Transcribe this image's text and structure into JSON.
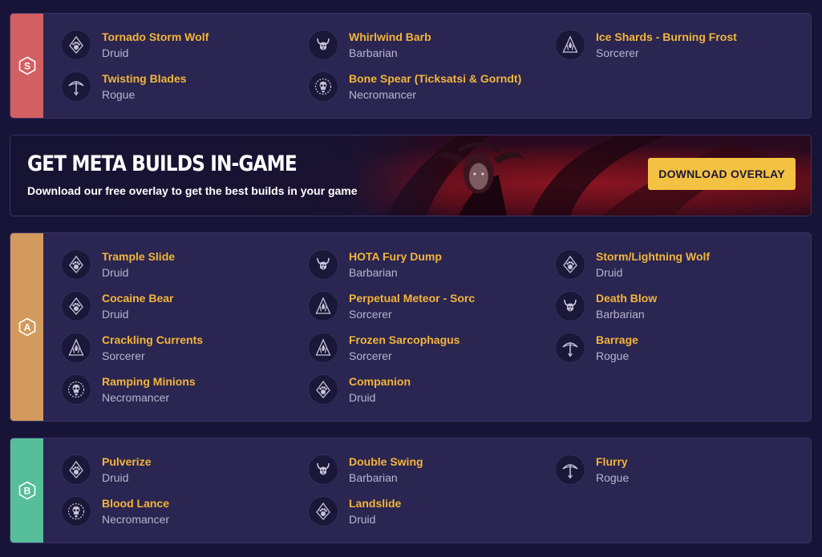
{
  "colors": {
    "page_bg": "#171437",
    "card_bg": "#2a2551",
    "build_name": "#f3b53a",
    "build_class": "#b9b5cf",
    "tier_s": "#d25f62",
    "tier_a": "#d39a5e",
    "tier_b": "#56be9b",
    "button_bg": "#f3c242"
  },
  "tiers": {
    "s": {
      "label": "S",
      "builds": [
        {
          "name": "Tornado Storm Wolf",
          "class": "Druid",
          "icon": "druid-class-icon"
        },
        {
          "name": "Whirlwind Barb",
          "class": "Barbarian",
          "icon": "barbarian-class-icon"
        },
        {
          "name": "Ice Shards - Burning Frost",
          "class": "Sorcerer",
          "icon": "sorcerer-class-icon"
        },
        {
          "name": "Twisting Blades",
          "class": "Rogue",
          "icon": "rogue-class-icon"
        },
        {
          "name": "Bone Spear (Ticksatsi & Gorndt)",
          "class": "Necromancer",
          "icon": "necromancer-class-icon"
        }
      ]
    },
    "a": {
      "label": "A",
      "builds": [
        {
          "name": "Trample Slide",
          "class": "Druid",
          "icon": "druid-class-icon"
        },
        {
          "name": "HOTA Fury Dump",
          "class": "Barbarian",
          "icon": "barbarian-class-icon"
        },
        {
          "name": "Storm/Lightning Wolf",
          "class": "Druid",
          "icon": "druid-class-icon"
        },
        {
          "name": "Cocaine Bear",
          "class": "Druid",
          "icon": "druid-class-icon"
        },
        {
          "name": "Perpetual Meteor - Sorc",
          "class": "Sorcerer",
          "icon": "sorcerer-class-icon"
        },
        {
          "name": "Death Blow",
          "class": "Barbarian",
          "icon": "barbarian-class-icon"
        },
        {
          "name": "Crackling Currents",
          "class": "Sorcerer",
          "icon": "sorcerer-class-icon"
        },
        {
          "name": "Frozen Sarcophagus",
          "class": "Sorcerer",
          "icon": "sorcerer-class-icon"
        },
        {
          "name": "Barrage",
          "class": "Rogue",
          "icon": "rogue-class-icon"
        },
        {
          "name": "Ramping Minions",
          "class": "Necromancer",
          "icon": "necromancer-class-icon"
        },
        {
          "name": "Companion",
          "class": "Druid",
          "icon": "druid-class-icon"
        }
      ]
    },
    "b": {
      "label": "B",
      "builds": [
        {
          "name": "Pulverize",
          "class": "Druid",
          "icon": "druid-class-icon"
        },
        {
          "name": "Double Swing",
          "class": "Barbarian",
          "icon": "barbarian-class-icon"
        },
        {
          "name": "Flurry",
          "class": "Rogue",
          "icon": "rogue-class-icon"
        },
        {
          "name": "Blood Lance",
          "class": "Necromancer",
          "icon": "necromancer-class-icon"
        },
        {
          "name": "Landslide",
          "class": "Druid",
          "icon": "druid-class-icon"
        }
      ]
    }
  },
  "promo": {
    "title": "GET META BUILDS IN-GAME",
    "subtitle": "Download our free overlay to get the best builds in your game",
    "button_label": "DOWNLOAD OVERLAY"
  }
}
